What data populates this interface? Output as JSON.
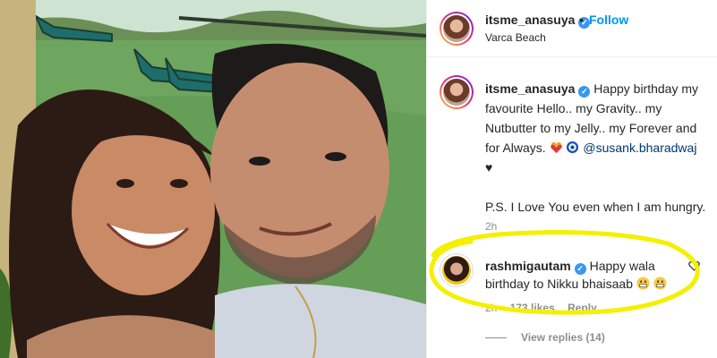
{
  "post": {
    "username": "itsme_anasuya",
    "follow_label": "Follow",
    "separator": "•",
    "location": "Varca Beach"
  },
  "caption": {
    "username": "itsme_anasuya",
    "text_part1": "Happy birthday my favourite Hello.. my Gravity.. my Nutbutter to my Jelly.. my Forever and for Always.",
    "mention": "@susank.bharadwaj",
    "heart": "♥",
    "text_part2": "P.S. I Love You even when I am hungry.",
    "time": "2h"
  },
  "comment": {
    "username": "rashmigautam",
    "text": "Happy wala birthday to Nikku bhaisaab",
    "time": "2h",
    "likes": "173 likes",
    "reply_label": "Reply",
    "view_replies": "View replies (14)"
  },
  "icons": {
    "verified": "verified-badge-icon",
    "like": "heart-outline-icon"
  },
  "colors": {
    "link_blue": "#0095f6",
    "verified_blue": "#3897f0",
    "highlight_yellow": "#f4f000"
  }
}
